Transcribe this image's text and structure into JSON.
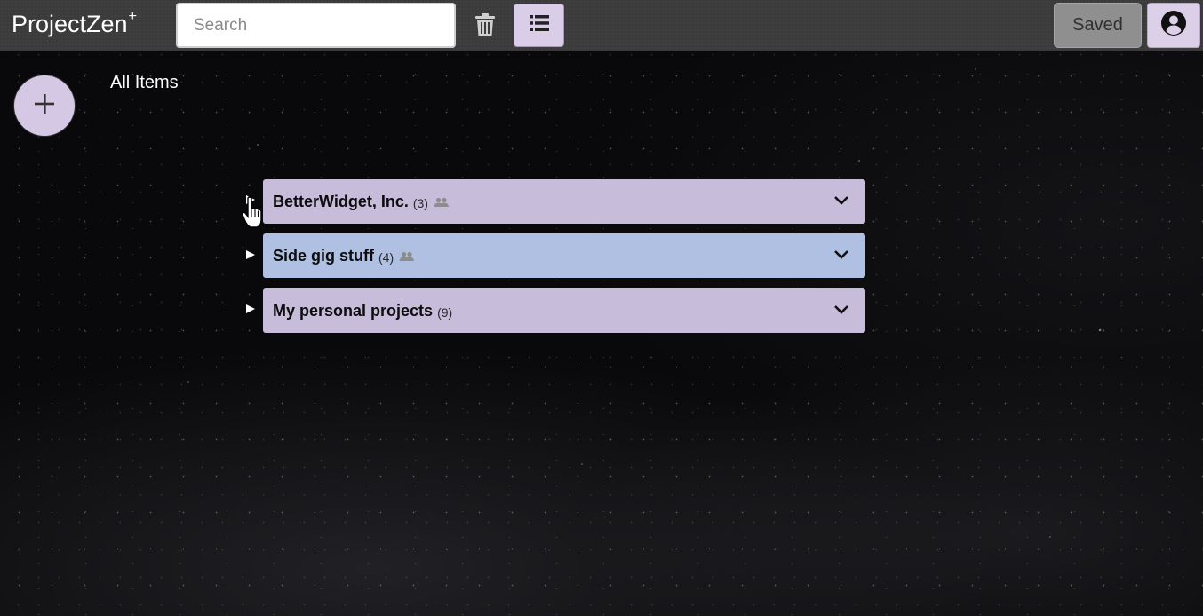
{
  "app": {
    "brand": "ProjectZen",
    "brand_sup": "+"
  },
  "header": {
    "search_placeholder": "Search",
    "saved_label": "Saved",
    "icons": {
      "trash": "trash-icon",
      "list": "list-view-icon",
      "user": "user-account-icon"
    },
    "colors": {
      "topbar": "#3b3b3b",
      "list_button": "#d9cde7",
      "saved_button": "#8f8f8f"
    }
  },
  "main": {
    "add_icon": "plus-icon",
    "breadcrumb": "All Items",
    "rows": [
      {
        "title": "BetterWidget, Inc.",
        "count": "(3)",
        "shared": true,
        "color": "#c8bcdb"
      },
      {
        "title": "Side gig stuff",
        "count": "(4)",
        "shared": true,
        "color": "#b0c0e2"
      },
      {
        "title": "My personal projects",
        "count": "(9)",
        "shared": false,
        "color": "#c8bcdb"
      }
    ]
  }
}
